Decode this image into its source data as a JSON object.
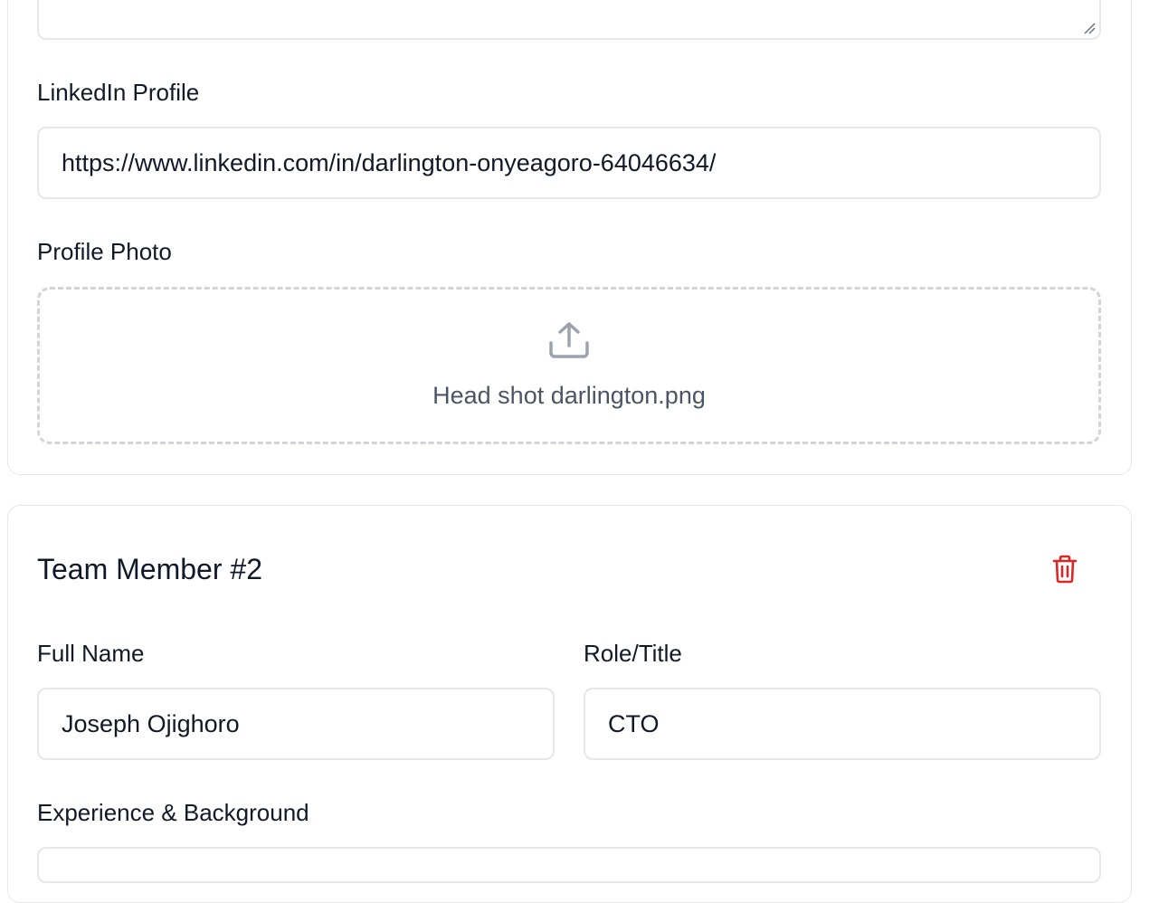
{
  "member1": {
    "linkedin_label": "LinkedIn Profile",
    "linkedin_value": "https://www.linkedin.com/in/darlington-onyeagoro-64046634/",
    "photo_label": "Profile Photo",
    "photo_filename": "Head shot darlington.png",
    "upload_icon": "upload-icon"
  },
  "member2": {
    "title": "Team Member #2",
    "delete_icon": "trash-icon",
    "full_name_label": "Full Name",
    "full_name_value": "Joseph Ojighoro",
    "role_label": "Role/Title",
    "role_value": "CTO",
    "experience_label": "Experience & Background"
  },
  "colors": {
    "border": "#e5e7eb",
    "danger": "#dc2626",
    "muted": "#4b5563",
    "icon_gray": "#9ca3af"
  }
}
